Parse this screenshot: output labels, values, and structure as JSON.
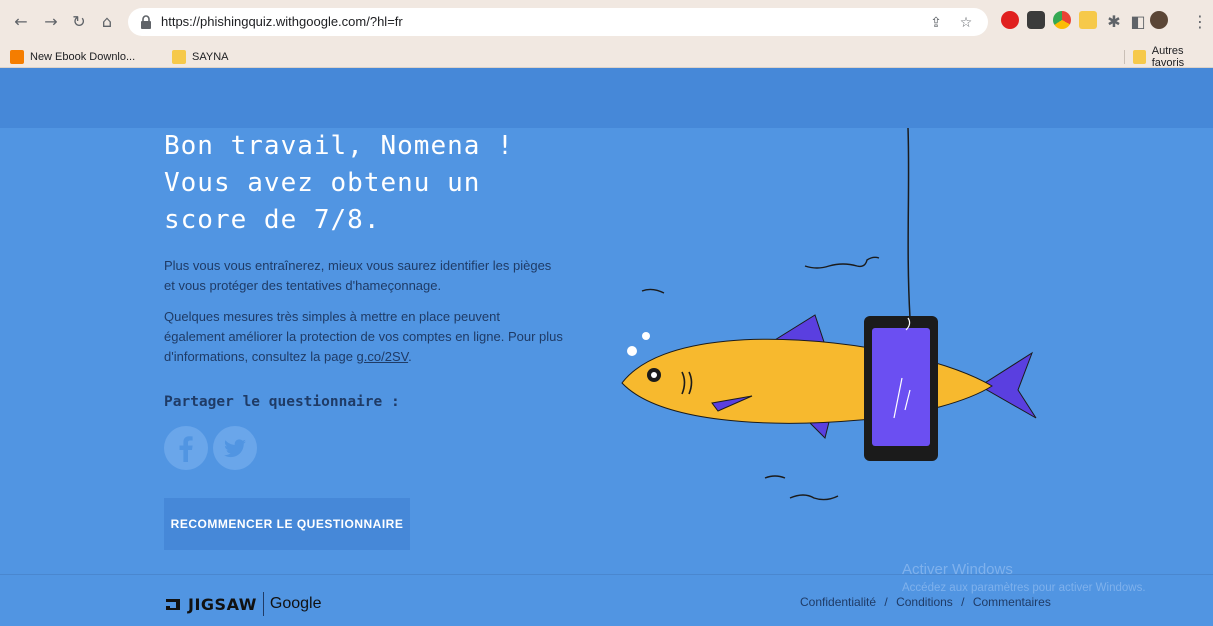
{
  "browser": {
    "url": "https://phishingquiz.withgoogle.com/?hl=fr",
    "icons": [
      "back-icon",
      "forward-icon",
      "reload-icon",
      "home-icon",
      "lock-icon",
      "share-icon",
      "star-icon",
      "extension-icon",
      "sidepanel-icon",
      "profile-avatar",
      "menu-icon"
    ],
    "bookmarks": [
      {
        "label": "New Ebook Downlo...",
        "icon": "blogger-icon"
      },
      {
        "label": "SAYNA",
        "icon": "folder-icon"
      }
    ],
    "other_bookmarks": "Autres favoris"
  },
  "main": {
    "headline": "Bon travail, Nomena !\nVous avez obtenu un\nscore de 7/8.",
    "para1": "Plus vous vous entraînerez, mieux vous saurez identifier les pièges et vous protéger des tentatives d'hameçonnage.",
    "para2": "Quelques mesures très simples à mettre en place peuvent également améliorer la protection de vos comptes en ligne. Pour plus d'informations, consultez la page ",
    "para2_link": "g.co/2SV",
    "para2_end": ".",
    "share_title": "Partager le questionnaire :",
    "restart_label": "RECOMMENCER LE QUESTIONNAIRE"
  },
  "footer": {
    "jigsaw": "JIGSAW",
    "google": "Google",
    "links": [
      "Confidentialité",
      "Conditions",
      "Commentaires"
    ],
    "separator": "/"
  },
  "watermark": {
    "title": "Activer Windows",
    "subtitle": "Accédez aux paramètres pour activer Windows."
  },
  "colors": {
    "page_bg": "#5195e2",
    "header_band": "#4688d8",
    "fish": "#f7b92e",
    "phone": "#6b4ff2",
    "fin": "#5a3fe0"
  }
}
